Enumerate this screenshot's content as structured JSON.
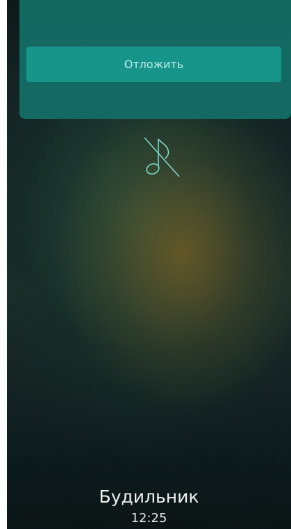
{
  "snooze": {
    "label": "Отложить"
  },
  "alarm": {
    "title": "Будильник",
    "time": "12:25"
  },
  "icons": {
    "ringtone": "music-note-off-icon"
  },
  "colors": {
    "panel": "#136860",
    "button": "#18958a",
    "button_text": "#bff0ea",
    "icon_stroke": "#7fd8cc"
  }
}
